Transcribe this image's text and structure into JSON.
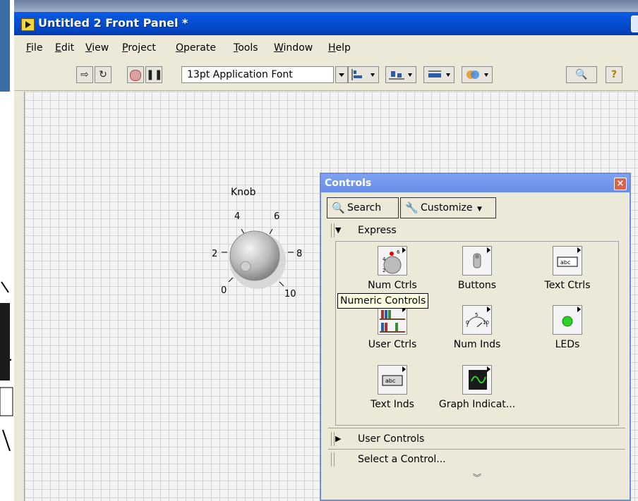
{
  "window": {
    "title": "Untitled 2 Front Panel *"
  },
  "menu": [
    "File",
    "Edit",
    "View",
    "Project",
    "Operate",
    "Tools",
    "Window",
    "Help"
  ],
  "toolbar": {
    "font": "13pt Application Font"
  },
  "knob": {
    "label": "Knob",
    "ticks": {
      "t0": "0",
      "t2": "2",
      "t4": "4",
      "t6": "6",
      "t8": "8",
      "t10": "10"
    }
  },
  "controls_palette": {
    "title": "Controls",
    "close": "×",
    "search": "Search",
    "customize": "Customize",
    "express": "Express",
    "items": [
      {
        "label": "Num Ctrls",
        "icon": "numeric-controls-icon"
      },
      {
        "label": "Buttons",
        "icon": "buttons-icon"
      },
      {
        "label": "Text Ctrls",
        "icon": "text-controls-icon"
      },
      {
        "label": "User Ctrls",
        "icon": "user-controls-icon"
      },
      {
        "label": "Num Inds",
        "icon": "numeric-indicators-icon"
      },
      {
        "label": "LEDs",
        "icon": "leds-icon"
      },
      {
        "label": "Text Inds",
        "icon": "text-indicators-icon"
      },
      {
        "label": "Graph Indicat...",
        "icon": "graph-indicators-icon"
      }
    ],
    "tooltip": "Numeric Controls",
    "user_controls": "User Controls",
    "select_control": "Select a Control...",
    "more": "»"
  }
}
